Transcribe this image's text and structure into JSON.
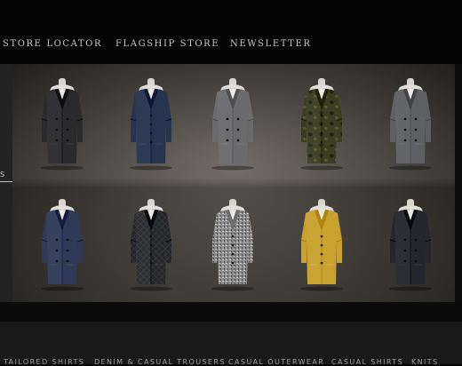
{
  "top_nav": {
    "items": [
      "STORE LOCATOR",
      "FLAGSHIP STORE",
      "NEWSLETTER"
    ]
  },
  "side_tab": {
    "label": "S"
  },
  "coats": [
    {
      "color": "#2a2a2d",
      "pattern": "solid",
      "buttons": "double"
    },
    {
      "color": "#27344f",
      "pattern": "solid",
      "buttons": "single"
    },
    {
      "color": "#6b6b6e",
      "pattern": "solid",
      "buttons": "double"
    },
    {
      "color": "#3a3d22",
      "pattern": "camo",
      "buttons": "single"
    },
    {
      "color": "#5e5f63",
      "pattern": "solid",
      "buttons": "double"
    },
    {
      "color": "#2e3a57",
      "pattern": "solid",
      "buttons": "double"
    },
    {
      "color": "#252629",
      "pattern": "quilted",
      "buttons": "single"
    },
    {
      "color": "#8a8a8a",
      "pattern": "tweed",
      "buttons": "single"
    },
    {
      "color": "#c9a12e",
      "pattern": "solid",
      "buttons": "single"
    },
    {
      "color": "#25262b",
      "pattern": "solid",
      "buttons": "double"
    }
  ],
  "categories": [
    "TAILORED SHIRTS",
    "DENIM & CASUAL TROUSERS",
    "CASUAL OUTERWEAR",
    "CASUAL SHIRTS",
    "KNITS"
  ]
}
